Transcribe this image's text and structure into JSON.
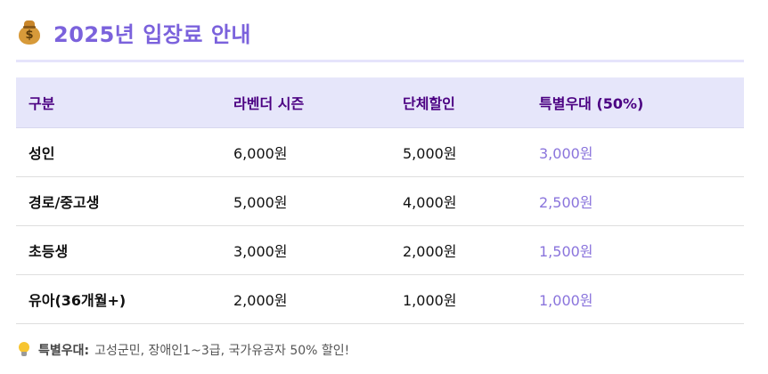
{
  "header": {
    "icon": "money-bag-icon",
    "title": "2025년 입장료 안내"
  },
  "table": {
    "columns": [
      "구분",
      "라벤더 시즌",
      "단체할인",
      "특별우대 (50%)"
    ],
    "rows": [
      [
        "성인",
        "6,000원",
        "5,000원",
        "3,000원"
      ],
      [
        "경로/중고생",
        "5,000원",
        "4,000원",
        "2,500원"
      ],
      [
        "초등생",
        "3,000원",
        "2,000원",
        "1,500원"
      ],
      [
        "유아(36개월+)",
        "2,000원",
        "1,000원",
        "1,000원"
      ]
    ]
  },
  "note": {
    "icon": "lightbulb-icon",
    "label": "특별우대:",
    "text": "고성군민, 장애인1~3급, 국가유공자 50% 할인!"
  },
  "colors": {
    "title": "#7b62dc",
    "header_bg": "#e6e6fa",
    "header_text": "#4b0082",
    "special_price": "#8a74dc",
    "rule": "#e6e4fb"
  }
}
